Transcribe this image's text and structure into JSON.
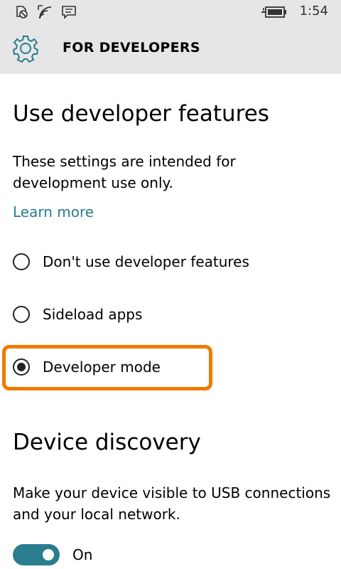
{
  "status_bar": {
    "time": "1:54",
    "icons": [
      "notification-icon",
      "wifi-icon",
      "message-icon",
      "battery-charging-icon"
    ]
  },
  "header": {
    "title": "FOR DEVELOPERS",
    "icon": "gear-icon"
  },
  "developer_features": {
    "title": "Use developer features",
    "description": "These settings are intended for development use only.",
    "link": "Learn more",
    "options": [
      {
        "label": "Don't use developer features",
        "selected": false
      },
      {
        "label": "Sideload apps",
        "selected": false
      },
      {
        "label": "Developer mode",
        "selected": true
      }
    ]
  },
  "device_discovery": {
    "title": "Device discovery",
    "description": "Make your device visible to USB connections and your local network.",
    "toggle_state": "On",
    "toggle_on": true
  },
  "colors": {
    "accent": "#2a7d8e",
    "highlight": "#f07a00",
    "header_bg": "#e6e6e6"
  }
}
